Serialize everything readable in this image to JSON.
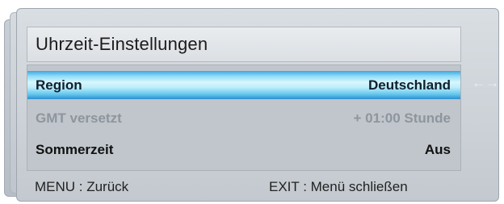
{
  "window": {
    "title": "Uhrzeit-Einstellungen"
  },
  "settings": [
    {
      "label": "Region",
      "value": "Deutschland",
      "state": "selected"
    },
    {
      "label": "GMT versetzt",
      "value": "+ 01:00 Stunde",
      "state": "disabled"
    },
    {
      "label": "Sommerzeit",
      "value": "Aus",
      "state": "normal"
    }
  ],
  "selection_hint": "←→",
  "footer": {
    "back": "MENU  : Zurück",
    "close": "EXIT    : Menü schließen"
  },
  "colors": {
    "selection_highlight": "#8fdcf7",
    "disabled_text": "#8e959c",
    "panel_background": "#c3c9cf"
  },
  "icons": [
    "left-right-arrow-icon"
  ]
}
